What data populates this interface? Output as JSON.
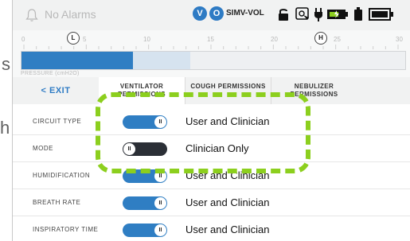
{
  "background": {
    "left_fragment_1": "s",
    "left_fragment_2": "h"
  },
  "status_bar": {
    "alarm_label": "No Alarms",
    "badge_v": "V",
    "badge_o": "O",
    "mode_label": "SIMV-VOL"
  },
  "scale": {
    "ticks": [
      "0",
      "5",
      "10",
      "15",
      "20",
      "25",
      "30"
    ],
    "marker_low": "L",
    "marker_high": "H",
    "bar_fill_fraction": 0.29,
    "bar_secondary_fraction": 0.44,
    "pressure_label": "PRESSURE (cmH2O)"
  },
  "tabs": {
    "exit": "< EXIT",
    "items": [
      {
        "label": "VENTILATOR PERMISSIONS",
        "active": true
      },
      {
        "label": "COUGH PERMISSIONS",
        "active": false
      },
      {
        "label": "NEBULIZER PERMISSIONS",
        "active": false
      }
    ]
  },
  "rows": [
    {
      "label": "CIRCUIT TYPE",
      "toggle_on": true,
      "value": "User and Clinician"
    },
    {
      "label": "MODE",
      "toggle_on": false,
      "value": "Clinician Only"
    },
    {
      "label": "HUMIDIFICATION",
      "toggle_on": true,
      "value": "User and Clinician"
    },
    {
      "label": "BREATH RATE",
      "toggle_on": true,
      "value": "User and Clinician"
    },
    {
      "label": "INSPIRATORY TIME",
      "toggle_on": true,
      "value": "User and Clinician"
    }
  ],
  "knob_glyph": "II",
  "colors": {
    "accent": "#2f7ec3",
    "toggle_off": "#2b2f36",
    "highlight": "#8ccf1e"
  }
}
